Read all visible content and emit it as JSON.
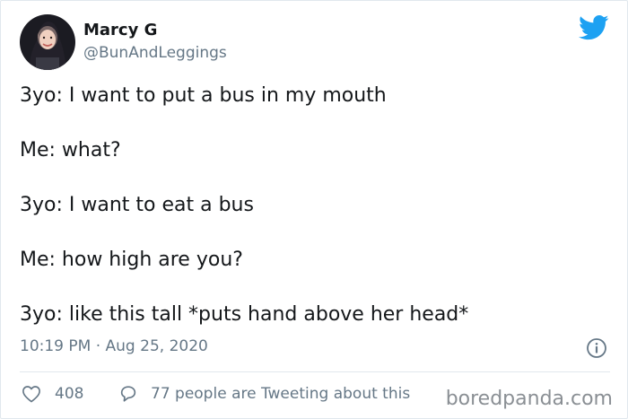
{
  "author": {
    "display_name": "Marcy G",
    "handle": "@BunAndLeggings",
    "avatar_icon": "profile-photo"
  },
  "brand": {
    "icon": "twitter-bird-icon",
    "color": "#1da1f2"
  },
  "tweet": {
    "lines": [
      "3yo: I want to put a bus in my mouth",
      "Me: what?",
      "3yo: I want to eat a bus",
      "Me: how high are you?",
      "3yo: like this tall *puts hand above her head*"
    ],
    "timestamp": "10:19 PM · Aug 25, 2020"
  },
  "actions": {
    "like_count": "408",
    "tweeting_text": "77 people are Tweeting about this"
  },
  "watermark": "boredpanda.com",
  "colors": {
    "text": "#14171a",
    "muted": "#657786",
    "border": "#e1e8ed"
  }
}
